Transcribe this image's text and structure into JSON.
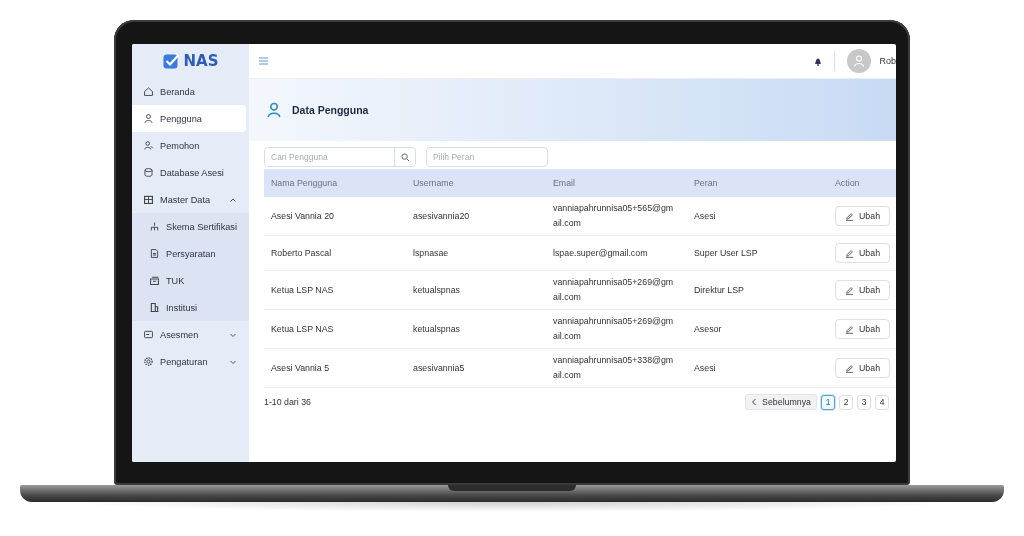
{
  "sidebar": {
    "logo": "NAS",
    "items": [
      {
        "label": "Beranda",
        "selected": false
      },
      {
        "label": "Pengguna",
        "selected": true
      },
      {
        "label": "Pemohon",
        "selected": false
      },
      {
        "label": "Database Asesi",
        "selected": false
      },
      {
        "label": "Master Data",
        "selected": false,
        "expanded": true,
        "children": [
          {
            "label": "Skema Sertifikasi",
            "selected": false
          },
          {
            "label": "Persyaratan",
            "selected": false
          },
          {
            "label": "TUK",
            "selected": false
          },
          {
            "label": "Institusi",
            "selected": false
          }
        ]
      },
      {
        "label": "Asesmen",
        "selected": false,
        "expanded": false
      },
      {
        "label": "Pengaturan",
        "selected": false,
        "expanded": false
      }
    ]
  },
  "topbar": {
    "user_name": "Rob"
  },
  "page": {
    "title": "Data Pengguna"
  },
  "filters": {
    "search": {
      "placeholder": "Cari Pengguna"
    },
    "role": {
      "placeholder": "Pilih Peran"
    }
  },
  "table": {
    "columns": [
      "Nama Pengguna",
      "Username",
      "Email",
      "Peran",
      "Action"
    ],
    "rows": [
      {
        "name": "Asesi Vannia 20",
        "username": "asesivannia20",
        "email": "vanniapahrunnisa05+565@gmail.com",
        "role": "Asesi",
        "action": "Ubah"
      },
      {
        "name": "Roberto Pascal",
        "username": "lspnasae",
        "email": "lspae.super@gmail.com",
        "role": "Super User LSP",
        "action": "Ubah"
      },
      {
        "name": "Ketua LSP NAS",
        "username": "ketualspnas",
        "email": "vanniapahrunnisa05+269@gmail.com",
        "role": "Direktur LSP",
        "action": "Ubah"
      },
      {
        "name": "Ketua LSP NAS",
        "username": "ketualspnas",
        "email": "vanniapahrunnisa05+269@gmail.com",
        "role": "Asesor",
        "action": "Ubah"
      },
      {
        "name": "Asesi Vannia 5",
        "username": "asesivannia5",
        "email": "vanniapahrunnisa05+338@gmail.com",
        "role": "Asesi",
        "action": "Ubah"
      }
    ]
  },
  "pagination": {
    "summary": "1-10 dari 36",
    "previous": "Sebelumnya",
    "pages": [
      {
        "label": "1",
        "selected": true
      },
      {
        "label": "2",
        "selected": false
      },
      {
        "label": "3",
        "selected": false
      },
      {
        "label": "4",
        "selected": false
      }
    ]
  }
}
